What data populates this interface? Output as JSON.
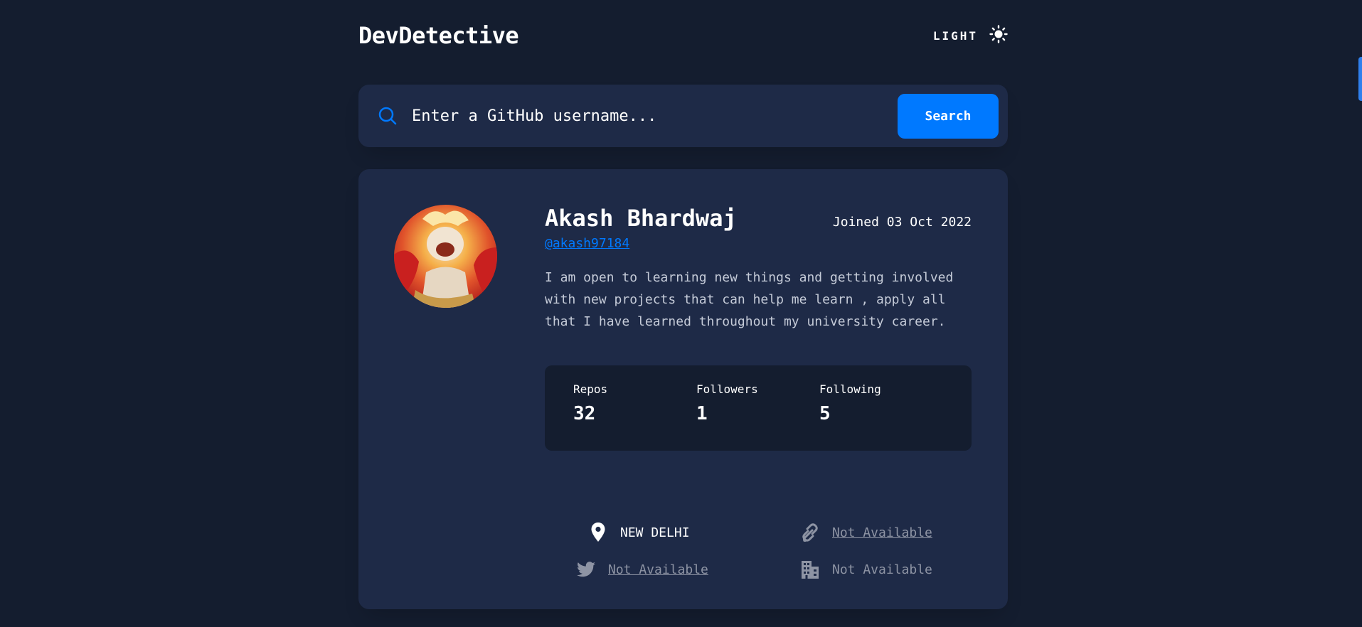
{
  "header": {
    "logo": "DevDetective",
    "mode_label": "LIGHT",
    "mode_icon": "sun-icon"
  },
  "search": {
    "placeholder": "Enter a GitHub username...",
    "button_label": "Search",
    "icon": "search-icon"
  },
  "profile": {
    "name": "Akash Bhardwaj",
    "joined": "Joined 03 Oct 2022",
    "username": "@akash97184",
    "bio": "I am open to learning new things and getting involved with new projects that can help me learn , apply all that I have learned throughout my university career.",
    "stats": [
      {
        "label": "Repos",
        "value": "32"
      },
      {
        "label": "Followers",
        "value": "1"
      },
      {
        "label": "Following",
        "value": "5"
      }
    ],
    "links": {
      "location": {
        "text": "NEW DELHI",
        "icon": "location-pin-icon"
      },
      "website": {
        "text": "Not Available",
        "icon": "link-icon"
      },
      "twitter": {
        "text": "Not Available",
        "icon": "twitter-icon"
      },
      "company": {
        "text": "Not Available",
        "icon": "building-icon"
      }
    }
  },
  "colors": {
    "background": "#141d2f",
    "card": "#1e2a47",
    "accent": "#0079ff",
    "muted": "#8e94a4"
  }
}
